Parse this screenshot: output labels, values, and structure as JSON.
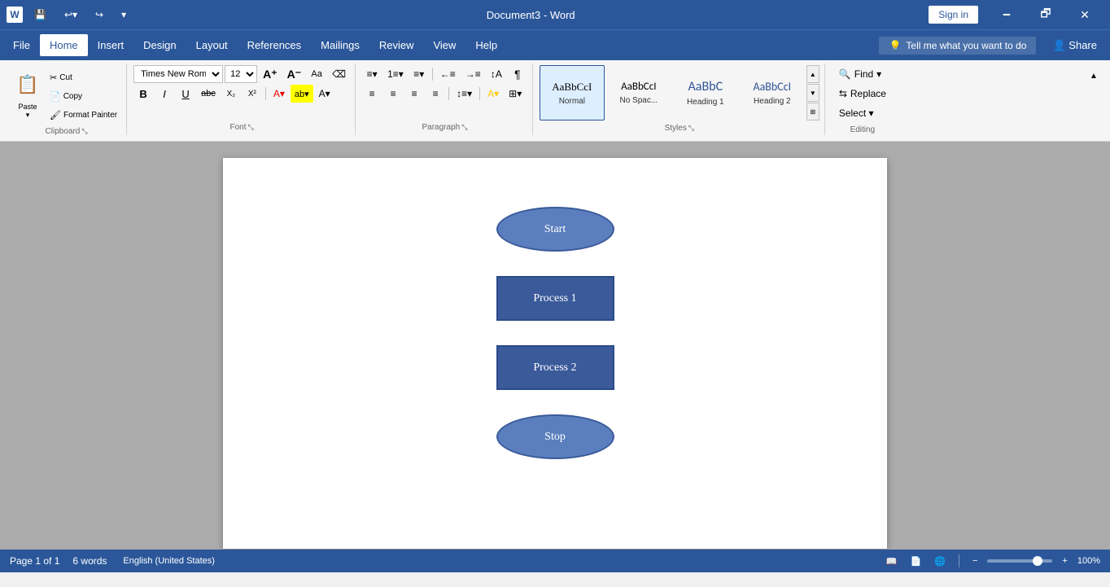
{
  "titlebar": {
    "app_name": "Word",
    "document_name": "Document3",
    "title_text": "Document3 - Word",
    "sign_in": "Sign in",
    "minimize": "🗕",
    "restore": "🗗",
    "close": "✕"
  },
  "menu": {
    "items": [
      "File",
      "Home",
      "Insert",
      "Design",
      "Layout",
      "References",
      "Mailings",
      "Review",
      "View",
      "Help"
    ],
    "active": "Home",
    "tell_me": "Tell me what you want to do",
    "share": "Share"
  },
  "ribbon": {
    "clipboard": {
      "label": "Clipboard",
      "paste": "Paste",
      "cut": "Cut",
      "copy": "Copy",
      "format_painter": "Format Painter"
    },
    "font": {
      "label": "Font",
      "font_name": "Times New Roman",
      "font_size": "12",
      "grow": "A",
      "shrink": "A",
      "change_case": "Aa",
      "clear_format": "✓",
      "bold": "B",
      "italic": "I",
      "underline": "U",
      "strikethrough": "abc",
      "subscript": "X₂",
      "superscript": "X²",
      "font_color": "A",
      "highlight": "ab",
      "text_color": "A"
    },
    "paragraph": {
      "label": "Paragraph",
      "bullets": "≡",
      "numbering": "1≡",
      "multilevel": "≡▾",
      "decrease_indent": "←",
      "increase_indent": "→",
      "sort": "↕",
      "show_marks": "¶",
      "align_left": "≡",
      "align_center": "≡",
      "align_right": "≡",
      "justify": "≡",
      "line_spacing": "↕",
      "shading": "A",
      "borders": "⊞"
    },
    "styles": {
      "label": "Styles",
      "normal_text": "AaBbCcI",
      "normal_label": "Normal",
      "nospace_text": "AaBbCcI",
      "nospace_label": "No Spac...",
      "heading1_text": "AaBbC",
      "heading1_label": "Heading 1",
      "heading2_text": "AaBbCcI",
      "heading2_label": "Heading 2"
    },
    "editing": {
      "label": "Editing",
      "find": "Find",
      "replace": "Replace",
      "select": "Select ▾"
    }
  },
  "document": {
    "shapes": [
      {
        "type": "oval",
        "label": "Start"
      },
      {
        "type": "rect",
        "label": "Process 1"
      },
      {
        "type": "rect",
        "label": "Process 2"
      },
      {
        "type": "oval",
        "label": "Stop"
      }
    ]
  },
  "statusbar": {
    "page_info": "Page 1 of 1",
    "word_count": "6 words",
    "language": "English (United States)",
    "zoom_percent": "100%"
  }
}
